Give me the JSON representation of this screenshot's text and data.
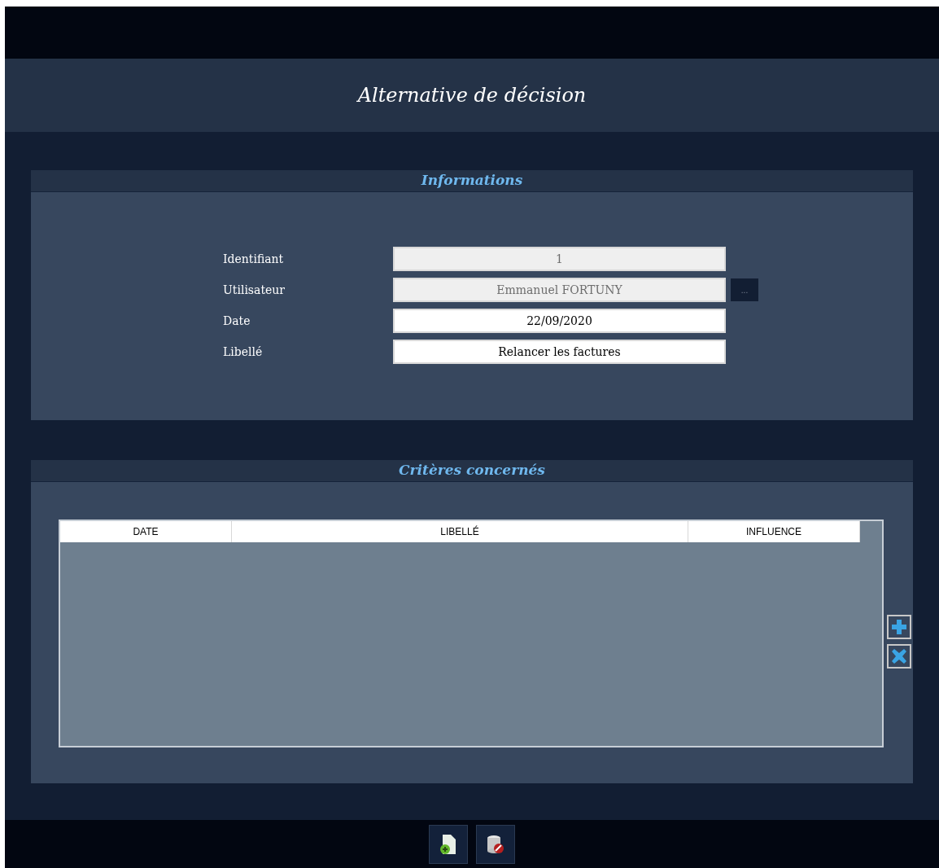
{
  "title": "Alternative de décision",
  "informations": {
    "heading": "Informations",
    "fields": [
      {
        "label": "Identifiant",
        "value": "1",
        "disabled": true
      },
      {
        "label": "Utilisateur",
        "value": "Emmanuel FORTUNY",
        "disabled": true,
        "button": "..."
      },
      {
        "label": "Date",
        "value": "22/09/2020",
        "disabled": false
      },
      {
        "label": "Libellé",
        "value": "Relancer les factures",
        "disabled": false
      }
    ]
  },
  "criteres": {
    "heading": "Critères concernés",
    "table": {
      "columns": [
        "DATE",
        "LIBELLÉ",
        "INFLUENCE"
      ]
    }
  }
}
